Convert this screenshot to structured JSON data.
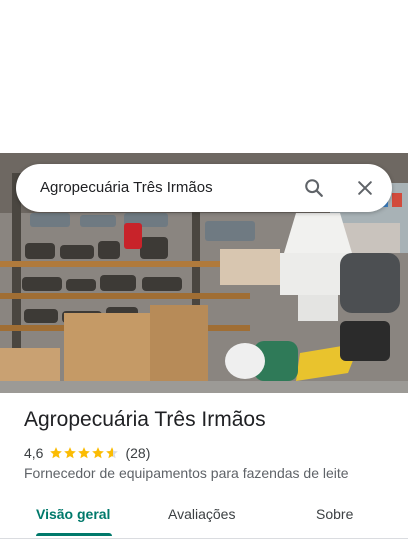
{
  "search": {
    "query": "Agropecuária Três Irmãos"
  },
  "place": {
    "name": "Agropecuária Três Irmãos",
    "rating": "4,6",
    "rating_stars": 4.6,
    "review_count": "(28)",
    "category": "Fornecedor de equipamentos para fazendas de leite"
  },
  "tabs": [
    {
      "label": "Visão geral",
      "active": true
    },
    {
      "label": "Avaliações",
      "active": false
    },
    {
      "label": "Sobre",
      "active": false
    }
  ],
  "colors": {
    "accent": "#00796b",
    "star": "#fbbc04",
    "text": "#202124"
  },
  "icons": {
    "search": "search-icon",
    "close": "close-icon",
    "star": "star-icon"
  }
}
